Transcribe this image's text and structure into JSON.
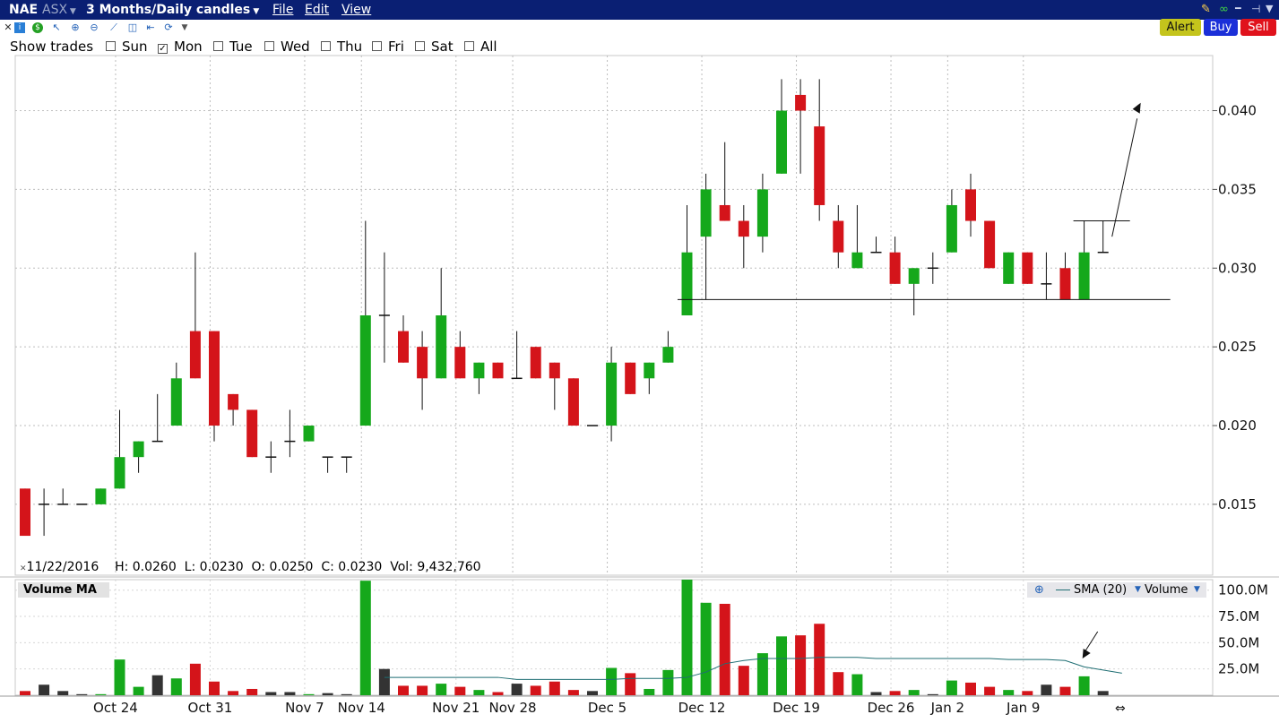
{
  "window": {
    "symbol": "NAE",
    "exchange": "ASX",
    "period": "3 Months/Daily candles",
    "menu": [
      "File",
      "Edit",
      "View"
    ]
  },
  "trade_buttons": {
    "alert": "Alert",
    "buy": "Buy",
    "sell": "Sell"
  },
  "colors": {
    "title_bar": "#0a1f73",
    "up": "#15a81b",
    "down": "#d4141a",
    "neutral": "#333333",
    "alert": "#b9b91a",
    "buy": "#1b2fd8",
    "sell": "#e0121c",
    "sma": "#1f6e73"
  },
  "show_trades": {
    "label": "Show trades",
    "days": [
      {
        "label": "Sun",
        "checked": false
      },
      {
        "label": "Mon",
        "checked": true
      },
      {
        "label": "Tue",
        "checked": false
      },
      {
        "label": "Wed",
        "checked": false
      },
      {
        "label": "Thu",
        "checked": false
      },
      {
        "label": "Fri",
        "checked": false
      },
      {
        "label": "Sat",
        "checked": false
      },
      {
        "label": "All",
        "checked": false
      }
    ]
  },
  "ohlc_readout": {
    "date": "11/22/2016",
    "high": "H: 0.0260",
    "low": "L: 0.0230",
    "open": "O: 0.0250",
    "close": "C: 0.0230",
    "volume": "Vol: 9,432,760"
  },
  "volume_panel": {
    "title": "Volume MA",
    "legend_sma": "SMA (20)",
    "legend_volume": "Volume",
    "y_ticks": [
      "100.0M",
      "75.0M",
      "50.0M",
      "25.0M"
    ]
  },
  "chart_data": {
    "type": "candlestick",
    "price_axis": {
      "ylim": [
        0.0105,
        0.0435
      ],
      "ticks": [
        "0.040",
        "0.035",
        "0.030",
        "0.025",
        "0.020",
        "0.015"
      ]
    },
    "volume_axis": {
      "ylim": [
        0,
        110
      ],
      "unit": "M"
    },
    "x_labels": [
      {
        "label": "Oct 24",
        "index": 5
      },
      {
        "label": "Oct 31",
        "index": 10
      },
      {
        "label": "Nov 7",
        "index": 15
      },
      {
        "label": "Nov 14",
        "index": 18
      },
      {
        "label": "Nov 21",
        "index": 23
      },
      {
        "label": "Nov 28",
        "index": 26
      },
      {
        "label": "Dec 5",
        "index": 31
      },
      {
        "label": "Dec 12",
        "index": 36
      },
      {
        "label": "Dec 19",
        "index": 41
      },
      {
        "label": "Dec 26",
        "index": 46
      },
      {
        "label": "Jan 2",
        "index": 49
      },
      {
        "label": "Jan 9",
        "index": 53
      }
    ],
    "candles": [
      {
        "o": 0.016,
        "h": 0.016,
        "l": 0.013,
        "c": 0.013,
        "v": 4
      },
      {
        "o": 0.015,
        "h": 0.016,
        "l": 0.013,
        "c": 0.015,
        "v": 10
      },
      {
        "o": 0.015,
        "h": 0.016,
        "l": 0.015,
        "c": 0.015,
        "v": 4
      },
      {
        "o": 0.015,
        "h": 0.015,
        "l": 0.015,
        "c": 0.015,
        "v": 1
      },
      {
        "o": 0.015,
        "h": 0.016,
        "l": 0.015,
        "c": 0.016,
        "v": 1
      },
      {
        "o": 0.016,
        "h": 0.021,
        "l": 0.016,
        "c": 0.018,
        "v": 34
      },
      {
        "o": 0.018,
        "h": 0.019,
        "l": 0.017,
        "c": 0.019,
        "v": 8
      },
      {
        "o": 0.019,
        "h": 0.022,
        "l": 0.019,
        "c": 0.019,
        "v": 19
      },
      {
        "o": 0.02,
        "h": 0.024,
        "l": 0.02,
        "c": 0.023,
        "v": 16
      },
      {
        "o": 0.026,
        "h": 0.031,
        "l": 0.023,
        "c": 0.023,
        "v": 30
      },
      {
        "o": 0.026,
        "h": 0.026,
        "l": 0.019,
        "c": 0.02,
        "v": 13
      },
      {
        "o": 0.022,
        "h": 0.022,
        "l": 0.02,
        "c": 0.021,
        "v": 4
      },
      {
        "o": 0.021,
        "h": 0.021,
        "l": 0.018,
        "c": 0.018,
        "v": 6
      },
      {
        "o": 0.018,
        "h": 0.019,
        "l": 0.017,
        "c": 0.018,
        "v": 3
      },
      {
        "o": 0.019,
        "h": 0.021,
        "l": 0.018,
        "c": 0.019,
        "v": 3
      },
      {
        "o": 0.019,
        "h": 0.02,
        "l": 0.019,
        "c": 0.02,
        "v": 1
      },
      {
        "o": 0.018,
        "h": 0.018,
        "l": 0.017,
        "c": 0.018,
        "v": 2
      },
      {
        "o": 0.018,
        "h": 0.018,
        "l": 0.017,
        "c": 0.018,
        "v": 1
      },
      {
        "o": 0.02,
        "h": 0.033,
        "l": 0.02,
        "c": 0.027,
        "v": 109
      },
      {
        "o": 0.027,
        "h": 0.031,
        "l": 0.024,
        "c": 0.027,
        "v": 25
      },
      {
        "o": 0.026,
        "h": 0.027,
        "l": 0.024,
        "c": 0.024,
        "v": 9
      },
      {
        "o": 0.025,
        "h": 0.026,
        "l": 0.021,
        "c": 0.023,
        "v": 9
      },
      {
        "o": 0.023,
        "h": 0.03,
        "l": 0.023,
        "c": 0.027,
        "v": 11
      },
      {
        "o": 0.025,
        "h": 0.026,
        "l": 0.023,
        "c": 0.023,
        "v": 8
      },
      {
        "o": 0.023,
        "h": 0.024,
        "l": 0.022,
        "c": 0.024,
        "v": 5
      },
      {
        "o": 0.024,
        "h": 0.024,
        "l": 0.023,
        "c": 0.023,
        "v": 3
      },
      {
        "o": 0.023,
        "h": 0.026,
        "l": 0.023,
        "c": 0.023,
        "v": 11
      },
      {
        "o": 0.025,
        "h": 0.025,
        "l": 0.023,
        "c": 0.023,
        "v": 9
      },
      {
        "o": 0.024,
        "h": 0.024,
        "l": 0.021,
        "c": 0.023,
        "v": 13
      },
      {
        "o": 0.023,
        "h": 0.023,
        "l": 0.02,
        "c": 0.02,
        "v": 5
      },
      {
        "o": 0.02,
        "h": 0.02,
        "l": 0.02,
        "c": 0.02,
        "v": 4
      },
      {
        "o": 0.02,
        "h": 0.025,
        "l": 0.019,
        "c": 0.024,
        "v": 26
      },
      {
        "o": 0.024,
        "h": 0.024,
        "l": 0.022,
        "c": 0.022,
        "v": 21
      },
      {
        "o": 0.023,
        "h": 0.024,
        "l": 0.022,
        "c": 0.024,
        "v": 6
      },
      {
        "o": 0.024,
        "h": 0.026,
        "l": 0.024,
        "c": 0.025,
        "v": 24
      },
      {
        "o": 0.027,
        "h": 0.034,
        "l": 0.027,
        "c": 0.031,
        "v": 110
      },
      {
        "o": 0.032,
        "h": 0.036,
        "l": 0.028,
        "c": 0.035,
        "v": 88
      },
      {
        "o": 0.034,
        "h": 0.038,
        "l": 0.033,
        "c": 0.033,
        "v": 87
      },
      {
        "o": 0.033,
        "h": 0.034,
        "l": 0.03,
        "c": 0.032,
        "v": 28
      },
      {
        "o": 0.032,
        "h": 0.036,
        "l": 0.031,
        "c": 0.035,
        "v": 40
      },
      {
        "o": 0.036,
        "h": 0.042,
        "l": 0.036,
        "c": 0.04,
        "v": 56
      },
      {
        "o": 0.041,
        "h": 0.042,
        "l": 0.036,
        "c": 0.04,
        "v": 57
      },
      {
        "o": 0.039,
        "h": 0.042,
        "l": 0.033,
        "c": 0.034,
        "v": 68
      },
      {
        "o": 0.033,
        "h": 0.034,
        "l": 0.03,
        "c": 0.031,
        "v": 22
      },
      {
        "o": 0.03,
        "h": 0.034,
        "l": 0.03,
        "c": 0.031,
        "v": 20
      },
      {
        "o": 0.031,
        "h": 0.032,
        "l": 0.031,
        "c": 0.031,
        "v": 3
      },
      {
        "o": 0.031,
        "h": 0.032,
        "l": 0.029,
        "c": 0.029,
        "v": 4
      },
      {
        "o": 0.029,
        "h": 0.03,
        "l": 0.027,
        "c": 0.03,
        "v": 5
      },
      {
        "o": 0.03,
        "h": 0.031,
        "l": 0.029,
        "c": 0.03,
        "v": 1
      },
      {
        "o": 0.031,
        "h": 0.035,
        "l": 0.031,
        "c": 0.034,
        "v": 14
      },
      {
        "o": 0.035,
        "h": 0.036,
        "l": 0.032,
        "c": 0.033,
        "v": 12
      },
      {
        "o": 0.033,
        "h": 0.033,
        "l": 0.03,
        "c": 0.03,
        "v": 8
      },
      {
        "o": 0.029,
        "h": 0.031,
        "l": 0.029,
        "c": 0.031,
        "v": 5
      },
      {
        "o": 0.031,
        "h": 0.031,
        "l": 0.029,
        "c": 0.029,
        "v": 4
      },
      {
        "o": 0.029,
        "h": 0.031,
        "l": 0.028,
        "c": 0.029,
        "v": 10
      },
      {
        "o": 0.03,
        "h": 0.031,
        "l": 0.028,
        "c": 0.028,
        "v": 8
      },
      {
        "o": 0.028,
        "h": 0.033,
        "l": 0.028,
        "c": 0.031,
        "v": 18
      },
      {
        "o": 0.031,
        "h": 0.033,
        "l": 0.031,
        "c": 0.031,
        "v": 4
      }
    ],
    "sma20": [
      null,
      null,
      null,
      null,
      null,
      null,
      null,
      null,
      null,
      null,
      null,
      null,
      null,
      null,
      null,
      null,
      null,
      null,
      17,
      17,
      17,
      17,
      17,
      17,
      17,
      15,
      15,
      15,
      15,
      15,
      15,
      16,
      16,
      16,
      17,
      22,
      30,
      33,
      35,
      35,
      35,
      36,
      36,
      36,
      35,
      35,
      35,
      35,
      35,
      35,
      35,
      34,
      34,
      34,
      33,
      27,
      24,
      21
    ],
    "annotations": [
      {
        "type": "support_line",
        "price": 0.028
      },
      {
        "type": "resistance_line",
        "price": 0.033
      },
      {
        "type": "arrow_up_on_price"
      },
      {
        "type": "arrow_down_on_volume"
      }
    ]
  }
}
